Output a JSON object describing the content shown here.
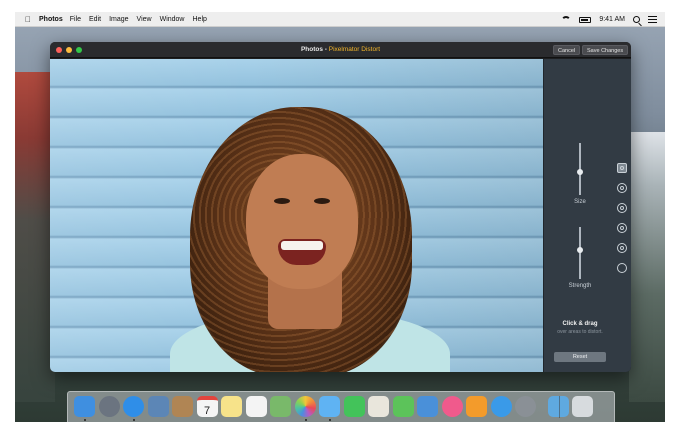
{
  "menubar": {
    "app_name": "Photos",
    "menus": [
      "File",
      "Edit",
      "Image",
      "View",
      "Window",
      "Help"
    ],
    "clock": "9:41 AM"
  },
  "window": {
    "title_app": "Photos",
    "title_separator": " - ",
    "title_plugin": "Pixelmator Distort",
    "cancel_label": "Cancel",
    "save_label": "Save Changes"
  },
  "panel": {
    "size_label": "Size",
    "size_value": 0.45,
    "strength_label": "Strength",
    "strength_value": 0.55,
    "tools": [
      "warp-tool",
      "bump-tool",
      "pinch-tool",
      "twirl-right-tool",
      "twirl-left-tool",
      "restore-tool"
    ],
    "selected_tool": 0,
    "hint_title": "Click & drag",
    "hint_subtitle": "over areas to distort.",
    "reset_label": "Reset"
  },
  "dock": {
    "apps": [
      {
        "name": "finder-icon",
        "color": "#3f8fe0"
      },
      {
        "name": "launchpad-icon",
        "color": "#6b7480"
      },
      {
        "name": "safari-icon",
        "color": "#2f8ee8"
      },
      {
        "name": "preview-icon",
        "color": "#5c86b6"
      },
      {
        "name": "contacts-icon",
        "color": "#b08554"
      },
      {
        "name": "calendar-icon",
        "color": "#f5f5f5"
      },
      {
        "name": "notes-icon",
        "color": "#f7e38a"
      },
      {
        "name": "reminders-icon",
        "color": "#f4f4f4"
      },
      {
        "name": "maps-icon",
        "color": "#79b96a"
      },
      {
        "name": "photos-icon",
        "color": "#f0a43a"
      },
      {
        "name": "messages-icon",
        "color": "#5fb3f3"
      },
      {
        "name": "facetime-icon",
        "color": "#43c35a"
      },
      {
        "name": "textedit-icon",
        "color": "#e9e6dc"
      },
      {
        "name": "numbers-icon",
        "color": "#5cc35a"
      },
      {
        "name": "keynote-icon",
        "color": "#4a90d9"
      },
      {
        "name": "itunes-icon",
        "color": "#f05a8c"
      },
      {
        "name": "ibooks-icon",
        "color": "#f39b2b"
      },
      {
        "name": "app-store-icon",
        "color": "#3a9ae8"
      },
      {
        "name": "system-preferences-icon",
        "color": "#8a9096"
      },
      {
        "name": "downloads-folder-icon",
        "color": "#5fa9e0"
      },
      {
        "name": "trash-icon",
        "color": "#d7dbde"
      }
    ],
    "calendar_day": "7"
  }
}
